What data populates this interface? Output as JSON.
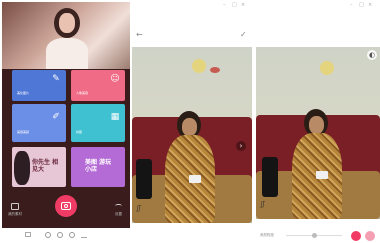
{
  "panel1": {
    "tiles": [
      {
        "label": "美化图片",
        "icon": "magic-wand-icon",
        "color": "#4f78d6"
      },
      {
        "label": "人像美容",
        "icon": "face-icon",
        "color": "#ef6b86"
      },
      {
        "label": "美容美颜",
        "icon": "brush-icon",
        "color": "#6b8ee6"
      },
      {
        "label": "拼图",
        "icon": "grid-icon",
        "color": "#3fc1d1"
      }
    ],
    "promos": [
      {
        "text": "你先生 相见大",
        "color": "#e7c6d6"
      },
      {
        "text": "美图 游玩小店",
        "color": "#b56bd6"
      }
    ],
    "bottom_left_label": "我的素材",
    "bottom_right_label": "设置",
    "accent_color": "#f03c64"
  },
  "panel2": {
    "back_icon": "back-arrow-icon",
    "confirm_icon": "check-icon",
    "nav_arrow_icon": "chevron-right-icon"
  },
  "panel3": {
    "bottom_label": "美颜程度",
    "accent_color": "#f03c64"
  }
}
